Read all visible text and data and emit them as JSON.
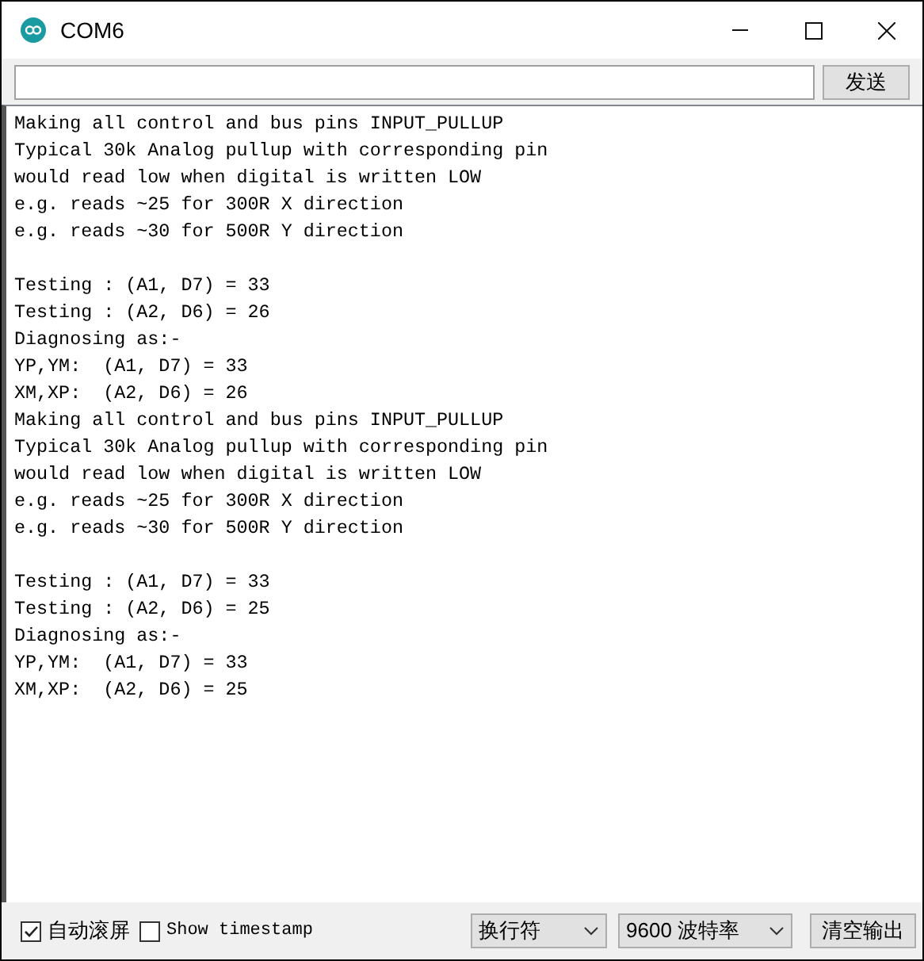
{
  "window": {
    "title": "COM6"
  },
  "send": {
    "button": "发送"
  },
  "output_blocks": [
    [
      "Making all control and bus pins INPUT_PULLUP",
      "Typical 30k Analog pullup with corresponding pin",
      "would read low when digital is written LOW",
      "e.g. reads ~25 for 300R X direction",
      "e.g. reads ~30 for 500R Y direction"
    ],
    [
      "Testing : (A1, D7) = 33",
      "Testing : (A2, D6) = 26",
      "Diagnosing as:-",
      "YP,YM:  (A1, D7) = 33",
      "XM,XP:  (A2, D6) = 26",
      "Making all control and bus pins INPUT_PULLUP",
      "Typical 30k Analog pullup with corresponding pin",
      "would read low when digital is written LOW",
      "e.g. reads ~25 for 300R X direction",
      "e.g. reads ~30 for 500R Y direction"
    ],
    [
      "Testing : (A1, D7) = 33",
      "Testing : (A2, D6) = 25",
      "Diagnosing as:-",
      "YP,YM:  (A1, D7) = 33",
      "XM,XP:  (A2, D6) = 25"
    ]
  ],
  "footer": {
    "autoscroll": {
      "label": "自动滚屏",
      "checked": true
    },
    "timestamp": {
      "label": "Show timestamp",
      "checked": false
    },
    "line_ending": "换行符",
    "baud": "9600 波特率",
    "clear_button": "清空输出"
  }
}
